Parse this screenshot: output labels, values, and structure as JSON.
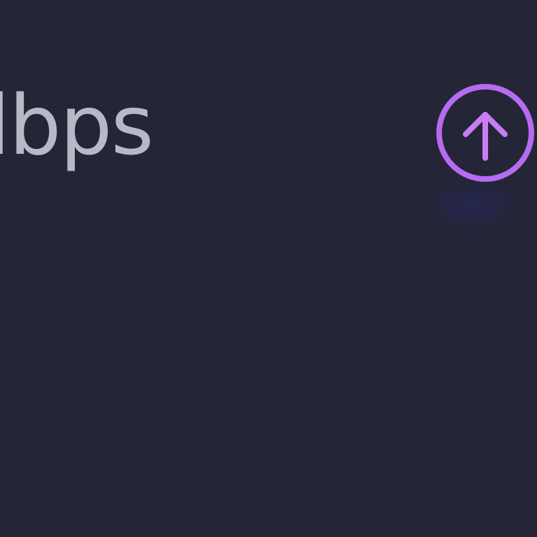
{
  "speed_panel": {
    "unit_label": "lbps",
    "upload_icon": "arrow-up-circle-icon"
  },
  "colors": {
    "background": "#242536",
    "text": "#b9b8c6",
    "accent": "#b66bf0"
  }
}
